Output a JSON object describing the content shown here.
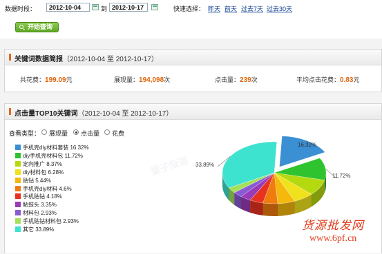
{
  "filter": {
    "date_label": "数据时段：",
    "start_date": "2012-10-04",
    "to_label": "到",
    "end_date": "2012-10-17",
    "quick_label": "快速选择：",
    "quick": [
      "昨天",
      "前天",
      "过去7天",
      "过去30天"
    ],
    "start_button": "开始查询"
  },
  "summary": {
    "title": "关键词数据简报",
    "range": "（2012-10-04 至  2012-10-17）",
    "total_cost_label": "共花费：",
    "total_cost_value": "199.09",
    "total_cost_unit": "元",
    "impressions_label": "展现量：",
    "impressions_value": "194,098",
    "impressions_unit": "次",
    "clicks_label": "点击量：",
    "clicks_value": "239",
    "clicks_unit": "次",
    "avg_cost_label": "平均点击花费：",
    "avg_cost_value": "0.83",
    "avg_cost_unit": "元"
  },
  "top10": {
    "title": "点击量TOP10关键词",
    "range": "（2012-10-04 至  2012-10-17）",
    "view_type_label": "查看类型：",
    "view_types": [
      "展现量",
      "点击量",
      "花费"
    ],
    "selected_view": "点击量"
  },
  "chart_data": {
    "type": "pie",
    "title": "",
    "slices": [
      {
        "label": "手机壳diy材料套装",
        "value": 16.32,
        "text": "手机壳diy材料套装  16.32%",
        "color": "#3b8fd3"
      },
      {
        "label": "diy手机壳材料包",
        "value": 11.72,
        "text": "diy手机壳材料包  11.72%",
        "color": "#2fc42f"
      },
      {
        "label": "定向推广",
        "value": 8.37,
        "text": "定向推广  8.37%",
        "color": "#b5d90f"
      },
      {
        "label": "diy材料包",
        "value": 6.28,
        "text": "diy材料包  6.28%",
        "color": "#efe21d"
      },
      {
        "label": "贴钻",
        "value": 5.44,
        "text": "贴钻  5.44%",
        "color": "#f5b80c"
      },
      {
        "label": "手机壳diy材料",
        "value": 4.6,
        "text": "手机壳diy材料  4.6%",
        "color": "#f07c10"
      },
      {
        "label": "手机贴钻",
        "value": 4.18,
        "text": "手机贴钻  4.18%",
        "color": "#e8321f"
      },
      {
        "label": "鲇鼓头",
        "value": 3.35,
        "text": "鲇鼓头  3.35%",
        "color": "#9a3bb8"
      },
      {
        "label": "材料包",
        "value": 2.93,
        "text": "材料包  2.93%",
        "color": "#8a5ad6"
      },
      {
        "label": "手机贴钻材料包",
        "value": 2.93,
        "text": "手机贴钻材料包  2.93%",
        "color": "#a4e05a"
      },
      {
        "label": "其它",
        "value": 33.89,
        "text": "其它  33.89%",
        "color": "#3ee3cf"
      }
    ],
    "labels_on_chart": [
      "16.32%",
      "11.72%",
      "33.89%"
    ]
  },
  "watermark": {
    "line1": "货源批发网",
    "line2": "www.6pf.cn",
    "faint": "量子恒道"
  }
}
